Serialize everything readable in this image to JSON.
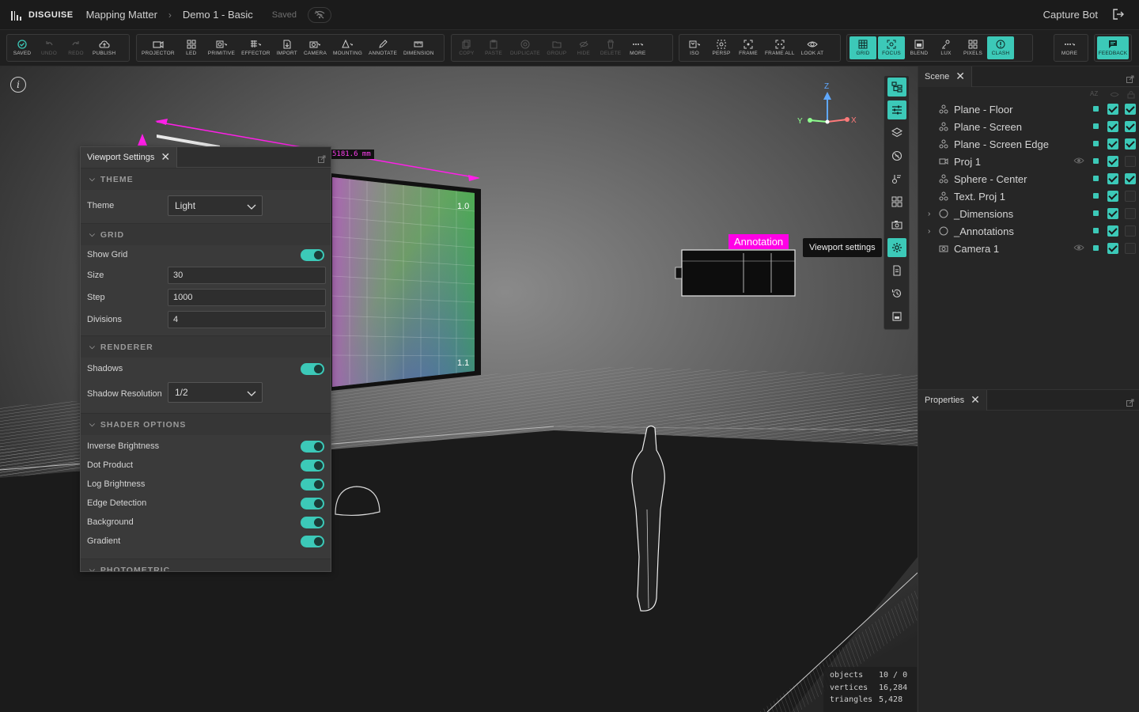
{
  "app": {
    "brand": "DISGUISE",
    "breadcrumb": [
      "Mapping Matter",
      "Demo 1 - Basic"
    ],
    "save_status": "Saved",
    "user": "Capture Bot"
  },
  "toolbar": {
    "groups": [
      [
        {
          "label": "SAVED",
          "icon": "check-circle-icon"
        },
        {
          "label": "UNDO",
          "icon": "undo-icon",
          "disabled": true
        },
        {
          "label": "REDO",
          "icon": "redo-icon",
          "disabled": true
        },
        {
          "label": "PUBLISH",
          "icon": "cloud-upload-icon"
        }
      ],
      [
        {
          "label": "PROJECTOR",
          "icon": "projector-icon"
        },
        {
          "label": "LED",
          "icon": "led-icon"
        },
        {
          "label": "PRIMITIVE",
          "icon": "primitive-icon"
        },
        {
          "label": "EFFECTOR",
          "icon": "effector-icon"
        },
        {
          "label": "IMPORT",
          "icon": "import-icon"
        },
        {
          "label": "CAMERA",
          "icon": "camera-icon"
        },
        {
          "label": "MOUNTING",
          "icon": "mounting-icon"
        },
        {
          "label": "ANNOTATE",
          "icon": "annotate-icon"
        },
        {
          "label": "DIMENSION",
          "icon": "dimension-icon"
        }
      ],
      [
        {
          "label": "COPY",
          "icon": "copy-icon",
          "disabled": true
        },
        {
          "label": "PASTE",
          "icon": "paste-icon",
          "disabled": true
        },
        {
          "label": "DUPLICATE",
          "icon": "duplicate-icon",
          "disabled": true
        },
        {
          "label": "GROUP",
          "icon": "group-icon",
          "disabled": true
        },
        {
          "label": "HIDE",
          "icon": "hide-icon",
          "disabled": true
        },
        {
          "label": "DELETE",
          "icon": "delete-icon",
          "disabled": true
        },
        {
          "label": "MORE",
          "icon": "more-icon"
        }
      ],
      [
        {
          "label": "ISO",
          "icon": "iso-icon"
        },
        {
          "label": "PERSP",
          "icon": "persp-icon"
        },
        {
          "label": "FRAME",
          "icon": "frame-icon"
        },
        {
          "label": "FRAME ALL",
          "icon": "frame-all-icon"
        },
        {
          "label": "LOOK AT",
          "icon": "look-at-icon"
        }
      ],
      [
        {
          "label": "GRID",
          "icon": "grid-icon",
          "active": true
        },
        {
          "label": "FOCUS",
          "icon": "focus-icon",
          "active": true
        },
        {
          "label": "BLEND",
          "icon": "blend-icon"
        },
        {
          "label": "LUX",
          "icon": "lux-icon"
        },
        {
          "label": "PIXELS",
          "icon": "pixels-icon"
        },
        {
          "label": "CLASH",
          "icon": "clash-icon",
          "active": true
        }
      ],
      [
        {
          "label": "MORE",
          "icon": "more-icon"
        }
      ],
      [
        {
          "label": "FEEDBACK",
          "icon": "feedback-icon",
          "active": true
        }
      ]
    ]
  },
  "viewport_settings": {
    "tab_title": "Viewport Settings",
    "sections": {
      "theme": {
        "title": "THEME",
        "theme_label": "Theme",
        "theme_value": "Light"
      },
      "grid": {
        "title": "GRID",
        "show_grid_label": "Show Grid",
        "show_grid": true,
        "size_label": "Size",
        "size_value": "30",
        "step_label": "Step",
        "step_value": "1000",
        "divisions_label": "Divisions",
        "divisions_value": "4"
      },
      "renderer": {
        "title": "RENDERER",
        "shadows_label": "Shadows",
        "shadows": true,
        "shadow_res_label": "Shadow Resolution",
        "shadow_res_value": "1/2"
      },
      "shader": {
        "title": "SHADER OPTIONS",
        "options": [
          {
            "label": "Inverse Brightness",
            "on": true
          },
          {
            "label": "Dot Product",
            "on": true
          },
          {
            "label": "Log Brightness",
            "on": true
          },
          {
            "label": "Edge Detection",
            "on": true
          },
          {
            "label": "Background",
            "on": true
          },
          {
            "label": "Gradient",
            "on": true
          }
        ]
      },
      "photometric": {
        "title": "PHOTOMETRIC"
      }
    }
  },
  "viewport": {
    "annotation_text": "Annotation",
    "dimension_text": "5181.6 mm",
    "tooltip": "Viewport settings",
    "axes": {
      "z": "Z",
      "y": "Y",
      "x": "X"
    },
    "screen_tile_corner_labels": [
      "1.0",
      "1.1"
    ],
    "stats": {
      "objects_label": "objects",
      "objects_value": "10 / 0",
      "vertices_label": "vertices",
      "vertices_value": "16,284",
      "triangles_label": "triangles",
      "triangles_value": "5,428"
    }
  },
  "scene_panel": {
    "title": "Scene",
    "sort_label": "AZ",
    "items": [
      {
        "name": "Plane - Floor",
        "icon": "mesh-icon",
        "visible_check": true,
        "lock_check": true
      },
      {
        "name": "Plane - Screen",
        "icon": "mesh-icon",
        "visible_check": true,
        "lock_check": true
      },
      {
        "name": "Plane - Screen Edge",
        "icon": "mesh-icon",
        "visible_check": true,
        "lock_check": true
      },
      {
        "name": "Proj 1",
        "icon": "projector-icon",
        "eye": true,
        "visible_check": true,
        "lock_check": false
      },
      {
        "name": "Sphere - Center",
        "icon": "mesh-icon",
        "visible_check": true,
        "lock_check": true
      },
      {
        "name": "Text. Proj 1",
        "icon": "mesh-icon",
        "visible_check": true,
        "lock_check": false
      },
      {
        "name": "_Dimensions",
        "icon": "group-circle-icon",
        "expandable": true,
        "visible_check": true,
        "lock_check": false
      },
      {
        "name": "_Annotations",
        "icon": "group-circle-icon",
        "expandable": true,
        "visible_check": true,
        "lock_check": false
      },
      {
        "name": "Camera 1",
        "icon": "camera-icon",
        "eye": true,
        "visible_check": true,
        "lock_check": false
      }
    ]
  },
  "properties_panel": {
    "title": "Properties"
  },
  "colors": {
    "accent": "#3cc9b8",
    "annotation": "#ff00e6",
    "background": "#1e1e1e"
  }
}
